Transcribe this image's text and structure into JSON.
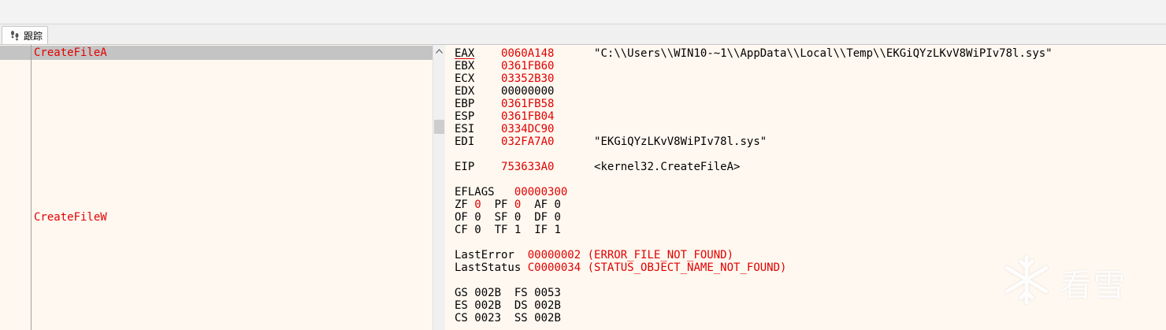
{
  "tab": {
    "label": "跟踪",
    "icon": "footprints-icon"
  },
  "trace": {
    "rows": [
      {
        "text": "CreateFileA",
        "selected": true
      },
      {
        "text": "CreateFileW",
        "selected": false
      }
    ]
  },
  "registers": {
    "gp": [
      {
        "name": "EAX",
        "value": "0060A148",
        "comment": "\"C:\\\\Users\\\\WIN10-~1\\\\AppData\\\\Local\\\\Temp\\\\EKGiQYzLKvV8WiPIv78l.sys\""
      },
      {
        "name": "EBX",
        "value": "0361FB60",
        "comment": ""
      },
      {
        "name": "ECX",
        "value": "03352B30",
        "comment": ""
      },
      {
        "name": "EDX",
        "value": "00000000",
        "comment": ""
      },
      {
        "name": "EBP",
        "value": "0361FB58",
        "comment": ""
      },
      {
        "name": "ESP",
        "value": "0361FB04",
        "comment": ""
      },
      {
        "name": "ESI",
        "value": "0334DC90",
        "comment": ""
      },
      {
        "name": "EDI",
        "value": "032FA7A0",
        "comment": "\"EKGiQYzLKvV8WiPIv78l.sys\""
      }
    ],
    "eip": {
      "name": "EIP",
      "value": "753633A0",
      "comment": "<kernel32.CreateFileA>"
    },
    "eflags": {
      "name": "EFLAGS",
      "value": "00000300"
    },
    "flags": [
      [
        "ZF",
        "0"
      ],
      [
        "PF",
        "0"
      ],
      [
        "AF",
        "0"
      ],
      [
        "OF",
        "0"
      ],
      [
        "SF",
        "0"
      ],
      [
        "DF",
        "0"
      ],
      [
        "CF",
        "0"
      ],
      [
        "TF",
        "1"
      ],
      [
        "IF",
        "1"
      ]
    ],
    "last_error": {
      "name": "LastError",
      "value": "00000002",
      "comment": "(ERROR_FILE_NOT_FOUND)"
    },
    "last_status": {
      "name": "LastStatus",
      "value": "C0000034",
      "comment": "(STATUS_OBJECT_NAME_NOT_FOUND)"
    },
    "segments": [
      [
        "GS",
        "002B"
      ],
      [
        "FS",
        "0053"
      ],
      [
        "ES",
        "002B"
      ],
      [
        "DS",
        "002B"
      ],
      [
        "CS",
        "0023"
      ],
      [
        "SS",
        "002B"
      ]
    ]
  },
  "watermark": {
    "text": "看雪",
    "icon": "snowflake-icon"
  },
  "colors": {
    "changed": "#e00000",
    "panel_bg": "#fff8f0",
    "selection": "#c4c4c4"
  }
}
